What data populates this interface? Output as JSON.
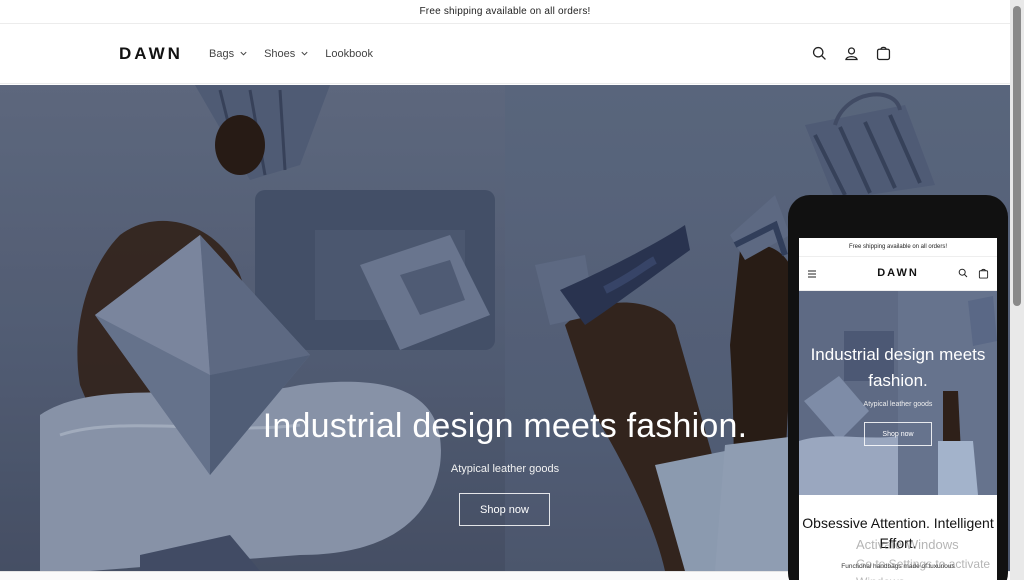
{
  "announcement": "Free shipping available on all orders!",
  "header": {
    "logo": "DAWN",
    "nav": [
      {
        "label": "Bags",
        "has_dropdown": true
      },
      {
        "label": "Shoes",
        "has_dropdown": true
      },
      {
        "label": "Lookbook",
        "has_dropdown": false
      }
    ],
    "icons": [
      "search-icon",
      "account-icon",
      "cart-icon"
    ]
  },
  "hero": {
    "title": "Industrial design meets fashion.",
    "subtitle": "Atypical leather goods",
    "button": "Shop now"
  },
  "mobile_preview": {
    "announcement": "Free shipping available on all orders!",
    "logo": "DAWN",
    "hero_title": "Industrial design meets fashion.",
    "hero_subtitle": "Atypical leather goods",
    "hero_button": "Shop now",
    "section_heading": "Obsessive Attention. Intelligent Effort.",
    "section_body": "Functional handbags made of luxurious"
  },
  "os_watermark": {
    "line1": "Activate Windows",
    "line2": "Go to Settings to activate Windows."
  },
  "colors": {
    "hero_bg": "#5a6780",
    "text": "#121212"
  }
}
